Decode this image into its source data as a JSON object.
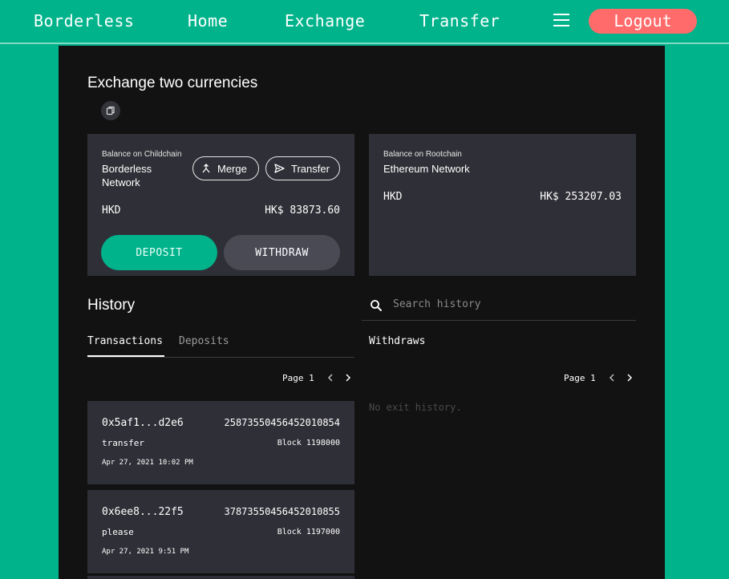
{
  "nav": {
    "brand": "Borderless",
    "home": "Home",
    "exchange": "Exchange",
    "transfer": "Transfer",
    "logout": "Logout"
  },
  "page": {
    "title": "Exchange two currencies"
  },
  "childchain": {
    "caption": "Balance on Childchain",
    "network_line1": "Borderless",
    "network_line2": "Network",
    "merge_label": "Merge",
    "transfer_label": "Transfer",
    "currency": "HKD",
    "amount": "HK$ 83873.60",
    "deposit_label": "DEPOSIT",
    "withdraw_label": "WITHDRAW"
  },
  "rootchain": {
    "caption": "Balance on Rootchain",
    "network": "Ethereum Network",
    "currency": "HKD",
    "amount": "HK$ 253207.03"
  },
  "history": {
    "title": "History",
    "search_placeholder": "Search history",
    "tabs": [
      "Transactions",
      "Deposits"
    ],
    "withdraws_label": "Withdraws",
    "page_label": "Page 1",
    "withdraws_page_label": "Page 1",
    "empty_withdraws": "No exit history.",
    "transactions": [
      {
        "hash": "0x5af1...d2e6",
        "value": "25873550456452010854",
        "type": "transfer",
        "block": "Block 1198000",
        "date": "Apr 27, 2021 10:02 PM"
      },
      {
        "hash": "0x6ee8...22f5",
        "value": "37873550456452010855",
        "type": "please",
        "block": "Block 1197000",
        "date": "Apr 27, 2021 9:51 PM"
      }
    ]
  },
  "colors": {
    "brand_green": "#00b38b",
    "logout_red": "#ff6b6b",
    "panel_bg": "#121212",
    "card_bg": "#2f2f37"
  }
}
